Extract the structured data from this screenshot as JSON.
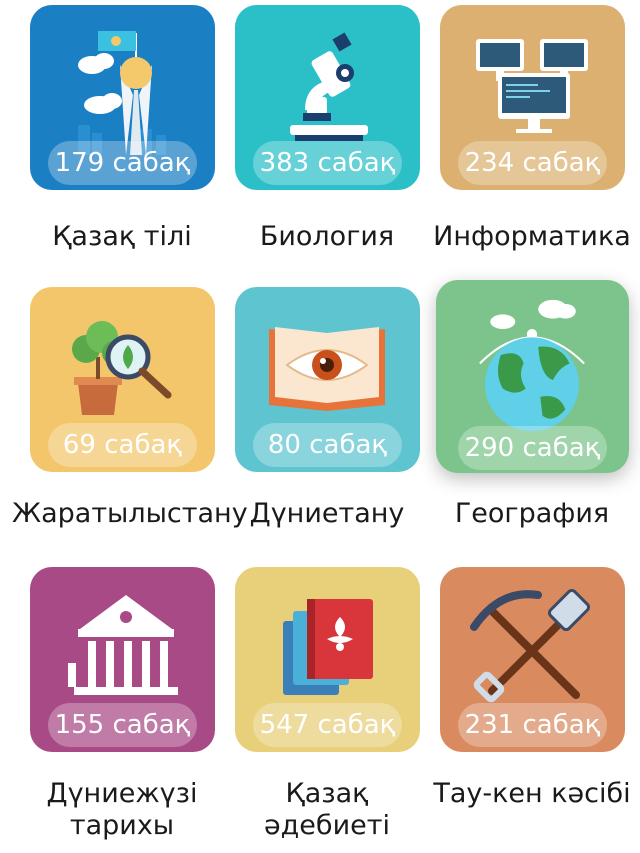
{
  "subjects": [
    {
      "name": "Қазақ тілі",
      "count": "179 сабақ",
      "color": "#1b7fc4",
      "icon": "astana-tower-icon"
    },
    {
      "name": "Биология",
      "count": "383 сабақ",
      "color": "#2bbfc8",
      "icon": "microscope-icon"
    },
    {
      "name": "Информатика",
      "count": "234 сабақ",
      "color": "#dbb070",
      "icon": "computers-icon"
    },
    {
      "name": "Жаратылыстану",
      "count": "69 сабақ",
      "color": "#f3c66b",
      "icon": "plant-magnifier-icon"
    },
    {
      "name": "Дүниетану",
      "count": "80 сабақ",
      "color": "#5ec4d0",
      "icon": "book-eye-icon"
    },
    {
      "name": "География",
      "count": "290 сабақ",
      "color": "#7cc48b",
      "icon": "globe-icon"
    },
    {
      "name_line1": "Дүниежүзі",
      "name_line2": "тарихы",
      "count": "155 сабақ",
      "color": "#a84a86",
      "icon": "museum-building-icon"
    },
    {
      "name_line1": "Қазақ",
      "name_line2": "әдебиеті",
      "count": "547 сабақ",
      "color": "#e8cf7a",
      "icon": "books-ornament-icon"
    },
    {
      "name": "Тау-кен кәсібі",
      "count": "231 сабақ",
      "color": "#d98a5f",
      "icon": "pickaxe-shovel-icon"
    }
  ]
}
